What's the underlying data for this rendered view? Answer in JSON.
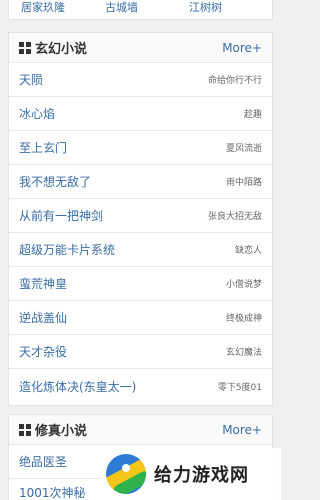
{
  "top_links": [
    "居家玖隆",
    "古城墙",
    "江树树"
  ],
  "xuanhuan": {
    "title": "玄幻小说",
    "more": "More+",
    "items": [
      {
        "book": "天陨",
        "author": "命给你行不行"
      },
      {
        "book": "冰心焰",
        "author": "趁趣"
      },
      {
        "book": "至上玄门",
        "author": "夏风流逝"
      },
      {
        "book": "我不想无敌了",
        "author": "雨中陌路"
      },
      {
        "book": "从前有一把神剑",
        "author": "张良大招无敌"
      },
      {
        "book": "超级万能卡片系统",
        "author": "缺恋人"
      },
      {
        "book": "蛮荒神皇",
        "author": "小僧说梦"
      },
      {
        "book": "逆战盖仙",
        "author": "终极成神"
      },
      {
        "book": "天才杂役",
        "author": "玄幻魔法"
      },
      {
        "book": "造化炼体决(东皇太一)",
        "author": "零下5度01"
      }
    ]
  },
  "xiuzhen": {
    "title": "修真小说",
    "more": "More+",
    "items": [
      {
        "book": "绝品医圣"
      },
      {
        "book": "1001次神秘"
      }
    ]
  },
  "watermark": {
    "text": "给力游戏网"
  }
}
